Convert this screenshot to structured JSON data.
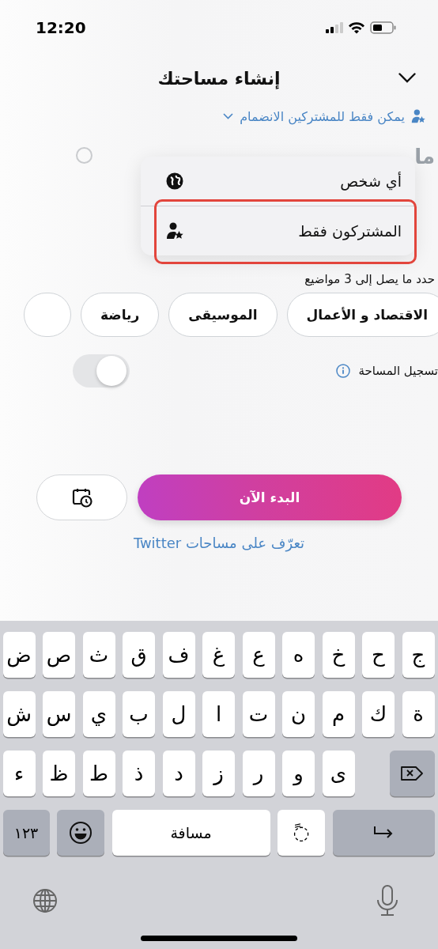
{
  "status_bar": {
    "time": "12:20"
  },
  "header": {
    "title": "إنشاء مساحتك"
  },
  "audience": {
    "label": "يمكن فقط للمشتركين الانضمام"
  },
  "audience_menu": {
    "items": [
      {
        "label": "أي شخص",
        "highlighted": false
      },
      {
        "label": "المشتركون فقط",
        "highlighted": true
      }
    ]
  },
  "title_field": {
    "value": "ما"
  },
  "topics": {
    "hint": "حدد ما يصل إلى 3 مواضيع",
    "chips": [
      {
        "label": "الاقتصاد و الأعمال",
        "selected": false
      },
      {
        "label": "الموسيقى",
        "selected": false
      },
      {
        "label": "رياضة",
        "selected": false
      }
    ]
  },
  "record": {
    "label": "تسجيل المساحة",
    "on": false
  },
  "actions": {
    "start": "البدء الآن",
    "learn_more": "تعرّف على مساحات Twitter"
  },
  "keyboard": {
    "rows": [
      [
        {
          "kind": "letter",
          "label": "ج"
        },
        {
          "kind": "letter",
          "label": "ح"
        },
        {
          "kind": "letter",
          "label": "خ"
        },
        {
          "kind": "letter",
          "label": "ه"
        },
        {
          "kind": "letter",
          "label": "ع"
        },
        {
          "kind": "letter",
          "label": "غ"
        },
        {
          "kind": "letter",
          "label": "ف"
        },
        {
          "kind": "letter",
          "label": "ق"
        },
        {
          "kind": "letter",
          "label": "ث"
        },
        {
          "kind": "letter",
          "label": "ص"
        },
        {
          "kind": "letter",
          "label": "ض"
        }
      ],
      [
        {
          "kind": "letter",
          "label": "ة"
        },
        {
          "kind": "letter",
          "label": "ك"
        },
        {
          "kind": "letter",
          "label": "م"
        },
        {
          "kind": "letter",
          "label": "ن"
        },
        {
          "kind": "letter",
          "label": "ت"
        },
        {
          "kind": "letter",
          "label": "ا"
        },
        {
          "kind": "letter",
          "label": "ل"
        },
        {
          "kind": "letter",
          "label": "ب"
        },
        {
          "kind": "letter",
          "label": "ي"
        },
        {
          "kind": "letter",
          "label": "س"
        },
        {
          "kind": "letter",
          "label": "ش"
        }
      ],
      [
        {
          "kind": "backspace"
        },
        "",
        {
          "kind": "letter",
          "label": "ى"
        },
        {
          "kind": "letter",
          "label": "و"
        },
        {
          "kind": "letter",
          "label": "ر"
        },
        {
          "kind": "letter",
          "label": "ز"
        },
        {
          "kind": "letter",
          "label": "د"
        },
        {
          "kind": "letter",
          "label": "ذ"
        },
        {
          "kind": "letter",
          "label": "ط"
        },
        {
          "kind": "letter",
          "label": "ظ"
        },
        {
          "kind": "letter",
          "label": "ء"
        }
      ],
      [
        {
          "kind": "return"
        },
        "",
        "",
        {
          "kind": "mark",
          "label": "◌ً"
        },
        "",
        "",
        {
          "kind": "space",
          "label": "مسافة"
        },
        "",
        {
          "kind": "emoji"
        },
        "",
        {
          "kind": "numbers",
          "label": "١٢٣"
        }
      ]
    ]
  }
}
